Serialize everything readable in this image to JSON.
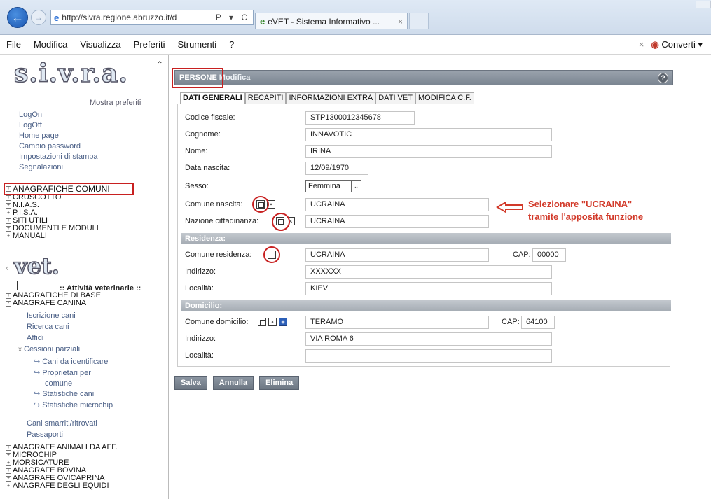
{
  "browser": {
    "url": "http://sivra.regione.abruzzo.it/d",
    "url_controls": "Ρ ▾ C",
    "tab_title": "eVET - Sistema Informativo ...",
    "menu": [
      "File",
      "Modifica",
      "Visualizza",
      "Preferiti",
      "Strumenti",
      "?"
    ],
    "convert_label": "Converti"
  },
  "sidebar": {
    "logo": "s.i.v.r.a.",
    "mostra_preferiti": "Mostra preferiti",
    "links": [
      "LogOn",
      "LogOff",
      "Home page",
      "Cambio password",
      "Impostazioni di stampa",
      "Segnalazioni"
    ],
    "tree_top": [
      "ANAGRAFICHE COMUNI",
      "CRUSCOTTO",
      "N.I.A.S.",
      "P.I.S.A.",
      "SITI UTILI",
      "DOCUMENTI E MODULI",
      "MANUALI"
    ],
    "vet_logo": "vet.",
    "attivita_title": ":: Attività veterinarie ::",
    "tree_mid": [
      "ANAGRAFICHE DI BASE",
      "ANAGRAFE CANINA"
    ],
    "canina_links": [
      "Iscrizione cani",
      "Ricerca cani",
      "Affidi",
      "Cessioni parziali"
    ],
    "cessioni_links": [
      "Cani da identificare",
      "Proprietari per",
      "comune",
      "Statistiche cani",
      "Statistiche microchip"
    ],
    "canina_links2": [
      "Cani smarriti/ritrovati",
      "Passaporti"
    ],
    "tree_bottom": [
      "ANAGRAFE ANIMALI DA AFF.",
      "MICROCHIP",
      "MORSICATURE",
      "ANAGRAFE BOVINA",
      "ANAGRAFE OVICAPRINA",
      "ANAGRAFE DEGLI EQUIDI"
    ]
  },
  "panel": {
    "title": "PERSONE",
    "subtitle": "Modifica",
    "help": "?",
    "tabs": [
      "DATI GENERALI",
      "RECAPITI",
      "INFORMAZIONI EXTRA",
      "DATI VET",
      "MODIFICA C.F."
    ],
    "fields": {
      "codice_fiscale": {
        "label": "Codice fiscale:",
        "value": "STP1300012345678"
      },
      "cognome": {
        "label": "Cognome:",
        "value": "INNAVOTIC"
      },
      "nome": {
        "label": "Nome:",
        "value": "IRINA"
      },
      "data_nascita": {
        "label": "Data nascita:",
        "value": "12/09/1970"
      },
      "sesso": {
        "label": "Sesso:",
        "value": "Femmina"
      },
      "comune_nascita": {
        "label": "Comune nascita:",
        "value": "UCRAINA"
      },
      "nazione_cittadinanza": {
        "label": "Nazione cittadinanza:",
        "value": "UCRAINA"
      }
    },
    "residenza": {
      "section": "Residenza:",
      "comune": {
        "label": "Comune residenza:",
        "value": "UCRAINA"
      },
      "cap": {
        "label": "CAP:",
        "value": "00000"
      },
      "indirizzo": {
        "label": "Indirizzo:",
        "value": "XXXXXX"
      },
      "localita": {
        "label": "Località:",
        "value": "KIEV"
      }
    },
    "domicilio": {
      "section": "Domicilio:",
      "comune": {
        "label": "Comune domicilio:",
        "value": "TERAMO"
      },
      "cap": {
        "label": "CAP:",
        "value": "64100"
      },
      "indirizzo": {
        "label": "Indirizzo:",
        "value": "VIA ROMA 6"
      },
      "localita": {
        "label": "Località:",
        "value": ""
      }
    },
    "buttons": {
      "salva": "Salva",
      "annulla": "Annulla",
      "elimina": "Elimina"
    }
  },
  "annotation": {
    "line1": "Selezionare \"UCRAINA\"",
    "line2": "tramite l'apposita funzione",
    "color": "#d23a2a"
  },
  "colors": {
    "highlight": "#c82020",
    "panel_header": "#7b8591",
    "link": "#4a5f86"
  }
}
